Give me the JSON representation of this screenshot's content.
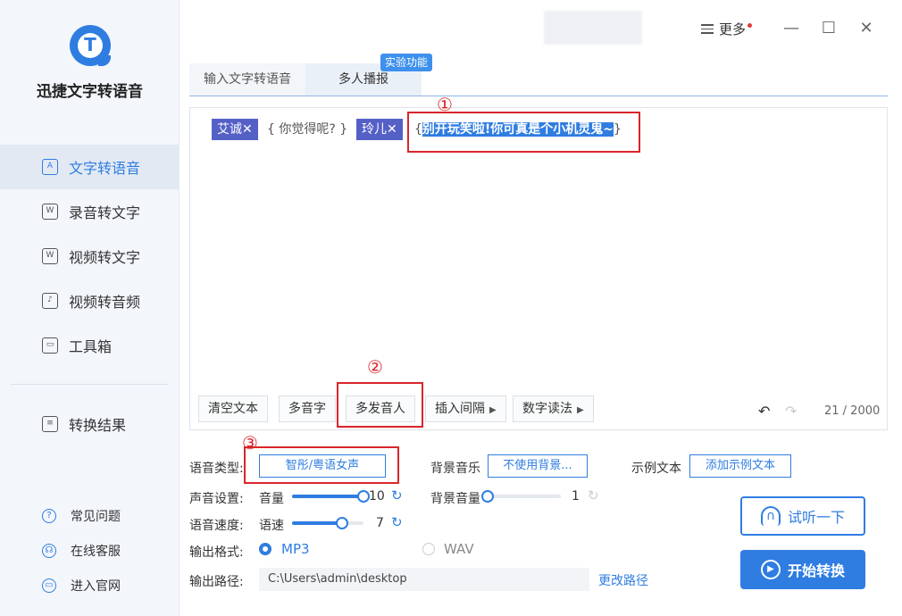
{
  "app": {
    "title": "迅捷文字转语音",
    "logo_letter": "T"
  },
  "sidebar": {
    "items": [
      {
        "label": "文字转语音",
        "icon": "text-speech-icon",
        "glyph": "A",
        "active": true
      },
      {
        "label": "录音转文字",
        "icon": "record-text-icon",
        "glyph": "W"
      },
      {
        "label": "视频转文字",
        "icon": "video-text-icon",
        "glyph": "W"
      },
      {
        "label": "视频转音频",
        "icon": "video-audio-icon",
        "glyph": "♪"
      },
      {
        "label": "工具箱",
        "icon": "toolbox-icon",
        "glyph": "▭"
      }
    ],
    "result": {
      "label": "转换结果",
      "glyph": "≡"
    },
    "links": [
      {
        "label": "常见问题",
        "glyph": "?"
      },
      {
        "label": "在线客服",
        "glyph": "☊"
      },
      {
        "label": "进入官网",
        "glyph": "▭"
      }
    ]
  },
  "titlebar": {
    "more_label": "更多",
    "minimize": "—",
    "maximize": "☐",
    "close": "✕"
  },
  "tabs": {
    "items": [
      "输入文字转语音",
      "多人播报"
    ],
    "badge": "实验功能"
  },
  "editor": {
    "chip1": "艾诚✕",
    "quote1": "{ 你觉得呢? }",
    "chip2": "玲儿✕",
    "quote2_open": "{",
    "quote2_sel": "别开玩笑啦!你可真是个小机灵鬼~",
    "quote2_close": "}",
    "marker1": "①",
    "marker2": "②",
    "marker3": "③",
    "buttons": {
      "clear": "清空文本",
      "polyphone": "多音字",
      "multi_speaker": "多发音人",
      "insert_pause": "插入间隔",
      "number_read": "数字读法"
    },
    "tri": "▶",
    "undo": "↶",
    "redo": "↷",
    "counter": "21 / 2000"
  },
  "settings": {
    "voice_type_label": "语音类型:",
    "voice_type_value": "智彤/粤语女声",
    "bgm_label": "背景音乐",
    "bgm_value": "不使用背景...",
    "sample_label": "示例文本",
    "sample_value": "添加示例文本",
    "sound_label": "声音设置:",
    "volume_label": "音量",
    "volume_value": "10",
    "bgm_volume_label": "背景音量",
    "bgm_volume_value": "1",
    "speed_label": "语音速度:",
    "speed_sub": "语速",
    "speed_value": "7",
    "refresh": "↻",
    "format_label": "输出格式:",
    "format_mp3": "MP3",
    "format_wav": "WAV",
    "path_label": "输出路径:",
    "path_value": "C:\\Users\\admin\\desktop",
    "change_path": "更改路径",
    "listen_label": "试听一下",
    "listen_glyph": "∩",
    "start_label": "开始转换",
    "start_glyph": "▶",
    "volume_level": 1.0,
    "bgm_volume_level": 0.0,
    "speed_level": 0.7
  },
  "colors": {
    "accent": "#2f7de1",
    "chip": "#5560c7",
    "highlight_box": "#d9262a"
  }
}
